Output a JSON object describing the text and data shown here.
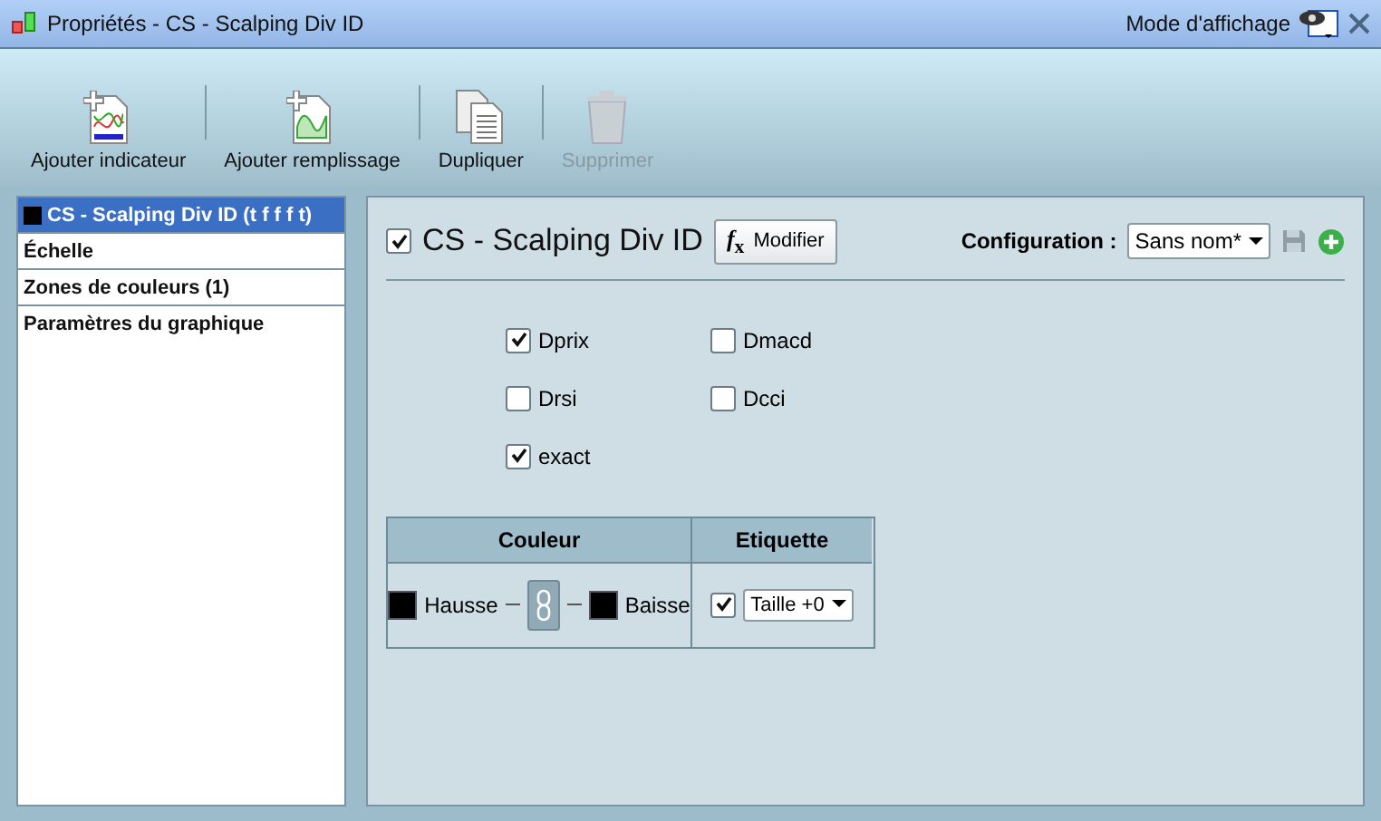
{
  "window": {
    "title": "Propriétés - CS - Scalping Div ID",
    "display_mode": "Mode d'affichage"
  },
  "toolbar": [
    {
      "label": "Ajouter indicateur",
      "kind": "indicator",
      "disabled": false
    },
    {
      "label": "Ajouter remplissage",
      "kind": "fill",
      "disabled": false
    },
    {
      "label": "Dupliquer",
      "kind": "duplicate",
      "disabled": false
    },
    {
      "label": "Supprimer",
      "kind": "delete",
      "disabled": true
    }
  ],
  "sidebar": {
    "items": [
      {
        "label": "CS - Scalping Div ID (t f f f t)",
        "selected": true,
        "color": "#000000"
      },
      {
        "label": "Échelle",
        "selected": false
      },
      {
        "label": "Zones de couleurs (1)",
        "selected": false
      },
      {
        "label": "Paramètres du graphique",
        "selected": false
      }
    ]
  },
  "panel": {
    "enabled": true,
    "title": "CS - Scalping Div ID",
    "modify_button": "Modifier",
    "modify_icon": "*f*$_{x}$",
    "configuration_label": "Configuration :",
    "configuration_value": "Sans nom*",
    "options": [
      {
        "label": "Dprix",
        "checked": true
      },
      {
        "label": "Dmacd",
        "checked": false
      },
      {
        "label": "Drsi",
        "checked": false
      },
      {
        "label": "Dcci",
        "checked": false
      },
      {
        "label": "exact",
        "checked": true
      }
    ],
    "table": {
      "columns": [
        "Couleur",
        "Etiquette"
      ],
      "up": {
        "label": "Hausse",
        "color": "#000000"
      },
      "down": {
        "label": "Baisse",
        "color": "#000000"
      },
      "label_checked": true,
      "size": "Taille +0"
    }
  }
}
